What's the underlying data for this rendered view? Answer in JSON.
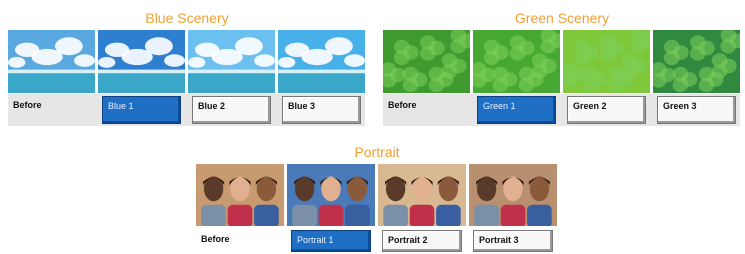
{
  "panels": [
    {
      "id": "blue",
      "title": "Blue Scenery",
      "items": [
        {
          "label": "Before",
          "state": "plain"
        },
        {
          "label": "Blue 1",
          "state": "selected"
        },
        {
          "label": "Blue 2",
          "state": "boxed"
        },
        {
          "label": "Blue 3",
          "state": "boxed"
        }
      ]
    },
    {
      "id": "green",
      "title": "Green Scenery",
      "items": [
        {
          "label": "Before",
          "state": "plain"
        },
        {
          "label": "Green 1",
          "state": "selected"
        },
        {
          "label": "Green 2",
          "state": "boxed"
        },
        {
          "label": "Green 3",
          "state": "boxed"
        }
      ]
    },
    {
      "id": "portrait",
      "title": "Portrait",
      "items": [
        {
          "label": "Before",
          "state": "plain"
        },
        {
          "label": "Portrait 1",
          "state": "selected"
        },
        {
          "label": "Portrait 2",
          "state": "boxed"
        },
        {
          "label": "Portrait 3",
          "state": "boxed"
        }
      ]
    }
  ],
  "colors": {
    "title": "#f0a030",
    "selected_button": "#1f6fc5",
    "sky_variants": [
      "#5aa8e0",
      "#2f7fd0",
      "#6cc0f0",
      "#48b0e8"
    ],
    "leaf_variants": [
      "#3f9a2f",
      "#46a832",
      "#7fc83a",
      "#2f8a40"
    ],
    "portrait_bg_variants": [
      "#c89a70",
      "#4a7ab8",
      "#d8b890",
      "#b89070"
    ]
  }
}
